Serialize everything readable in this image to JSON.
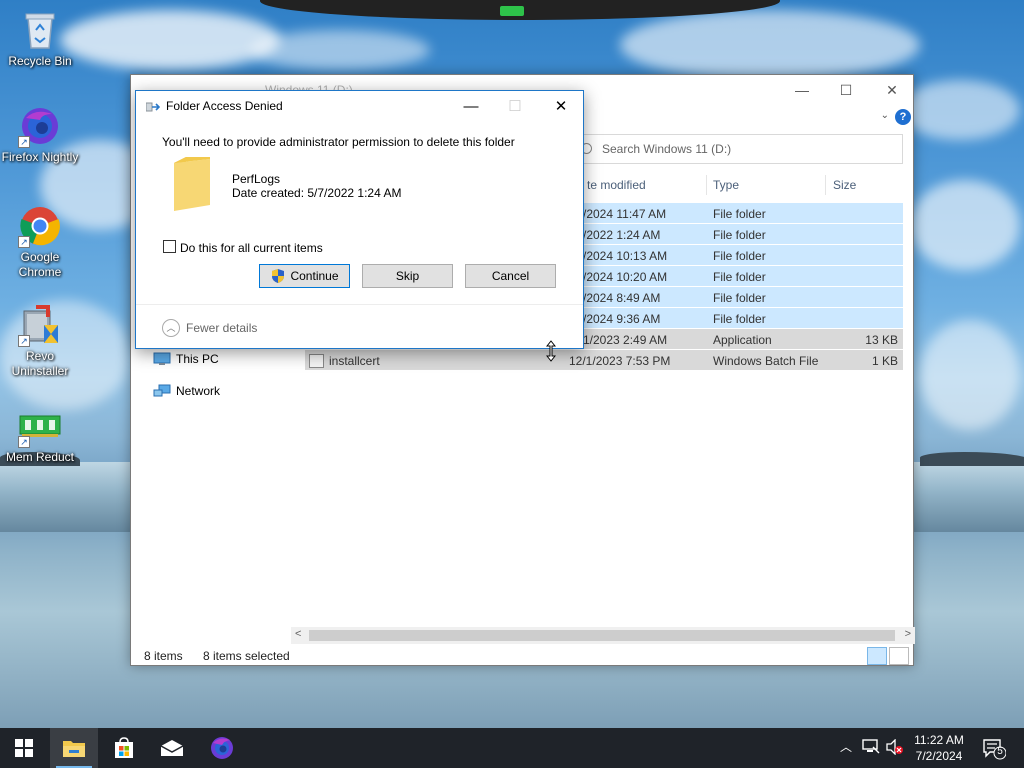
{
  "desktop": {
    "icons": [
      {
        "label": "Recycle Bin"
      },
      {
        "label": "Firefox Nightly"
      },
      {
        "label": "Google Chrome"
      },
      {
        "label": "Revo Uninstaller"
      },
      {
        "label": "Mem Reduct"
      }
    ]
  },
  "explorer": {
    "title": "Windows 11 (D:)",
    "search_placeholder": "Search Windows 11 (D:)",
    "columns": {
      "date": "te modified",
      "type": "Type",
      "size": "Size"
    },
    "nav": [
      {
        "label": "This PC",
        "icon": "computer-icon"
      },
      {
        "label": "Network",
        "icon": "network-icon"
      }
    ],
    "rows": [
      {
        "name": "",
        "date": "/2024 11:47 AM",
        "type": "File folder",
        "size": ""
      },
      {
        "name": "",
        "date": "/2022 1:24 AM",
        "type": "File folder",
        "size": ""
      },
      {
        "name": "",
        "date": "/2024 10:13 AM",
        "type": "File folder",
        "size": ""
      },
      {
        "name": "",
        "date": "/2024 10:20 AM",
        "type": "File folder",
        "size": ""
      },
      {
        "name": "",
        "date": "/2024 8:49 AM",
        "type": "File folder",
        "size": ""
      },
      {
        "name": "",
        "date": "/2024 9:36 AM",
        "type": "File folder",
        "size": ""
      },
      {
        "name": "",
        "date": "1/2023 2:49 AM",
        "type": "Application",
        "size": "13 KB"
      },
      {
        "name": "installcert",
        "date": "12/1/2023 7:53 PM",
        "type": "Windows Batch File",
        "size": "1 KB"
      }
    ],
    "status": {
      "items": "8 items",
      "selected": "8 items selected"
    }
  },
  "dialog": {
    "title": "Folder Access Denied",
    "message": "You'll need to provide administrator permission to delete this folder",
    "item_name": "PerfLogs",
    "item_date": "Date created: 5/7/2022 1:24 AM",
    "checkbox_label": "Do this for all current items",
    "checkbox_checked": false,
    "buttons": {
      "continue": "Continue",
      "skip": "Skip",
      "cancel": "Cancel"
    },
    "fewer_details": "Fewer details"
  },
  "taskbar": {
    "apps": [
      "start-icon",
      "file-explorer-icon",
      "store-icon",
      "mail-icon",
      "firefox-icon"
    ],
    "clock_time": "11:22 AM",
    "clock_date": "7/2/2024",
    "notification_count": "5"
  },
  "colors": {
    "accent": "#0078d7",
    "selection": "#cce8ff",
    "taskbar": "#1f2329",
    "folder": "#f7d774"
  }
}
